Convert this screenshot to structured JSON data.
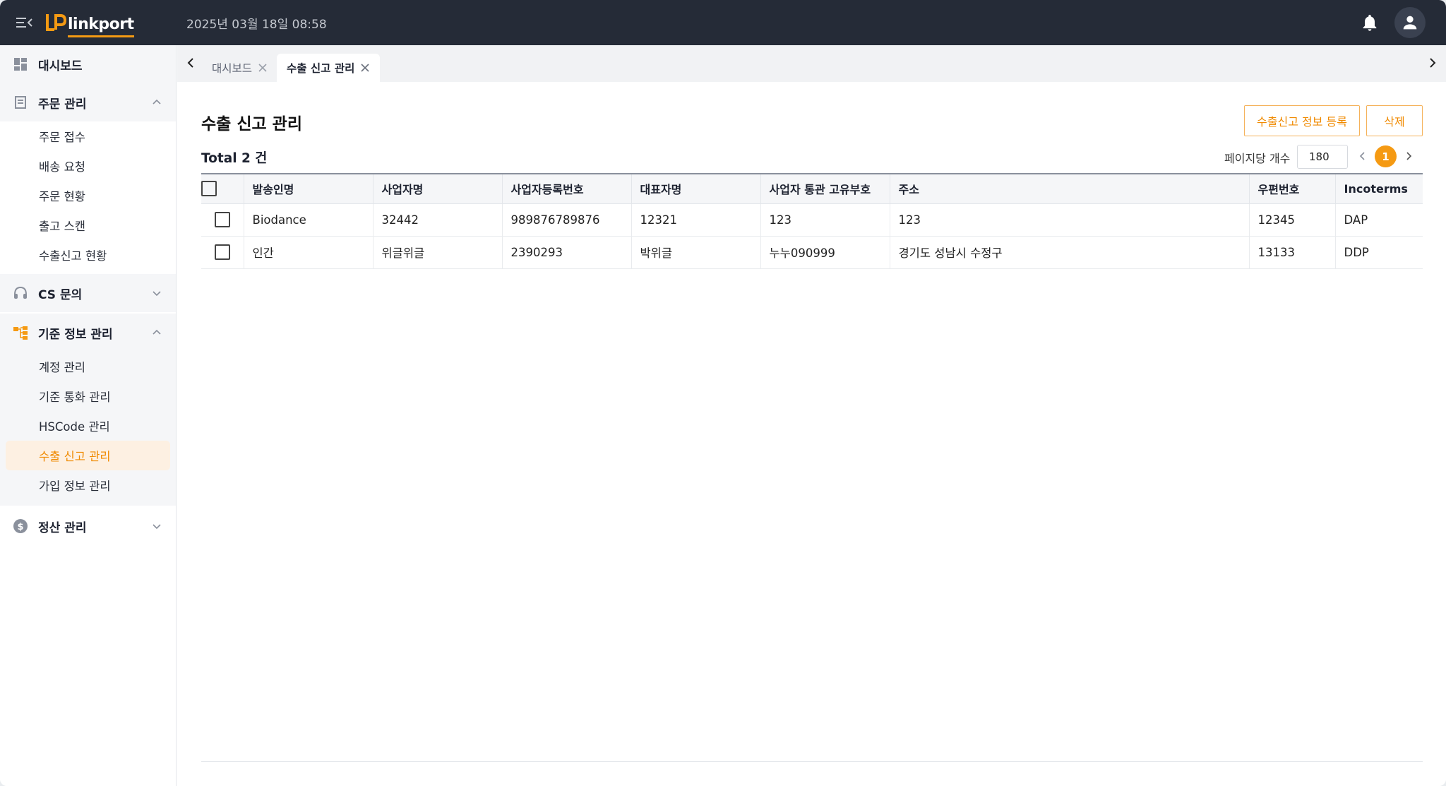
{
  "app": {
    "brand_prefix": "LP",
    "brand_name": "linkport",
    "datetime": "2025년 03월 18일 08:58",
    "accent_color": "#f59a13",
    "topbar_color": "#252b37"
  },
  "sidebar": {
    "dashboard": {
      "label": "대시보드",
      "icon": "dashboard-icon"
    },
    "orders": {
      "label": "주문 관리",
      "icon": "document-icon",
      "items": [
        "주문 접수",
        "배송 요청",
        "주문 현황",
        "출고 스캔",
        "수출신고 현황"
      ]
    },
    "cs": {
      "label": "CS 문의",
      "icon": "headset-icon"
    },
    "master": {
      "label": "기준 정보 관리",
      "icon": "hierarchy-icon",
      "items": [
        "계정 관리",
        "기준 통화 관리",
        "HSCode 관리",
        "수출 신고 관리",
        "가입 정보 관리"
      ],
      "active_index": 3
    },
    "settlement": {
      "label": "정산 관리",
      "icon": "dollar-icon"
    }
  },
  "tabs": [
    {
      "label": "대시보드",
      "active": false
    },
    {
      "label": "수출 신고 관리",
      "active": true
    }
  ],
  "page": {
    "title": "수출 신고 관리",
    "register_button": "수출신고 정보 등록",
    "delete_button": "삭제",
    "total_text": "Total 2 건",
    "per_page_label": "페이지당 개수",
    "per_page_value": "180",
    "current_page": "1"
  },
  "table": {
    "columns": [
      "발송인명",
      "사업자명",
      "사업자등록번호",
      "대표자명",
      "사업자 통관 고유부호",
      "주소",
      "우편번호",
      "Incoterms"
    ],
    "rows": [
      [
        "Biodance",
        "32442",
        "989876789876",
        "12321",
        "123",
        "123",
        "12345",
        "DAP"
      ],
      [
        "인간",
        "위글위글",
        "2390293",
        "박위글",
        "누누090999",
        "경기도 성남시 수정구",
        "13133",
        "DDP"
      ]
    ]
  }
}
